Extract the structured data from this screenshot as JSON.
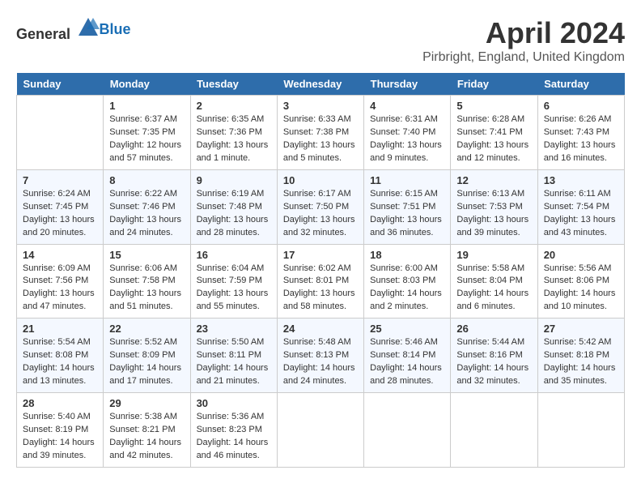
{
  "header": {
    "logo_general": "General",
    "logo_blue": "Blue",
    "month": "April 2024",
    "location": "Pirbright, England, United Kingdom"
  },
  "days_of_week": [
    "Sunday",
    "Monday",
    "Tuesday",
    "Wednesday",
    "Thursday",
    "Friday",
    "Saturday"
  ],
  "weeks": [
    [
      {
        "day": "",
        "text": ""
      },
      {
        "day": "1",
        "text": "Sunrise: 6:37 AM\nSunset: 7:35 PM\nDaylight: 12 hours\nand 57 minutes."
      },
      {
        "day": "2",
        "text": "Sunrise: 6:35 AM\nSunset: 7:36 PM\nDaylight: 13 hours\nand 1 minute."
      },
      {
        "day": "3",
        "text": "Sunrise: 6:33 AM\nSunset: 7:38 PM\nDaylight: 13 hours\nand 5 minutes."
      },
      {
        "day": "4",
        "text": "Sunrise: 6:31 AM\nSunset: 7:40 PM\nDaylight: 13 hours\nand 9 minutes."
      },
      {
        "day": "5",
        "text": "Sunrise: 6:28 AM\nSunset: 7:41 PM\nDaylight: 13 hours\nand 12 minutes."
      },
      {
        "day": "6",
        "text": "Sunrise: 6:26 AM\nSunset: 7:43 PM\nDaylight: 13 hours\nand 16 minutes."
      }
    ],
    [
      {
        "day": "7",
        "text": "Sunrise: 6:24 AM\nSunset: 7:45 PM\nDaylight: 13 hours\nand 20 minutes."
      },
      {
        "day": "8",
        "text": "Sunrise: 6:22 AM\nSunset: 7:46 PM\nDaylight: 13 hours\nand 24 minutes."
      },
      {
        "day": "9",
        "text": "Sunrise: 6:19 AM\nSunset: 7:48 PM\nDaylight: 13 hours\nand 28 minutes."
      },
      {
        "day": "10",
        "text": "Sunrise: 6:17 AM\nSunset: 7:50 PM\nDaylight: 13 hours\nand 32 minutes."
      },
      {
        "day": "11",
        "text": "Sunrise: 6:15 AM\nSunset: 7:51 PM\nDaylight: 13 hours\nand 36 minutes."
      },
      {
        "day": "12",
        "text": "Sunrise: 6:13 AM\nSunset: 7:53 PM\nDaylight: 13 hours\nand 39 minutes."
      },
      {
        "day": "13",
        "text": "Sunrise: 6:11 AM\nSunset: 7:54 PM\nDaylight: 13 hours\nand 43 minutes."
      }
    ],
    [
      {
        "day": "14",
        "text": "Sunrise: 6:09 AM\nSunset: 7:56 PM\nDaylight: 13 hours\nand 47 minutes."
      },
      {
        "day": "15",
        "text": "Sunrise: 6:06 AM\nSunset: 7:58 PM\nDaylight: 13 hours\nand 51 minutes."
      },
      {
        "day": "16",
        "text": "Sunrise: 6:04 AM\nSunset: 7:59 PM\nDaylight: 13 hours\nand 55 minutes."
      },
      {
        "day": "17",
        "text": "Sunrise: 6:02 AM\nSunset: 8:01 PM\nDaylight: 13 hours\nand 58 minutes."
      },
      {
        "day": "18",
        "text": "Sunrise: 6:00 AM\nSunset: 8:03 PM\nDaylight: 14 hours\nand 2 minutes."
      },
      {
        "day": "19",
        "text": "Sunrise: 5:58 AM\nSunset: 8:04 PM\nDaylight: 14 hours\nand 6 minutes."
      },
      {
        "day": "20",
        "text": "Sunrise: 5:56 AM\nSunset: 8:06 PM\nDaylight: 14 hours\nand 10 minutes."
      }
    ],
    [
      {
        "day": "21",
        "text": "Sunrise: 5:54 AM\nSunset: 8:08 PM\nDaylight: 14 hours\nand 13 minutes."
      },
      {
        "day": "22",
        "text": "Sunrise: 5:52 AM\nSunset: 8:09 PM\nDaylight: 14 hours\nand 17 minutes."
      },
      {
        "day": "23",
        "text": "Sunrise: 5:50 AM\nSunset: 8:11 PM\nDaylight: 14 hours\nand 21 minutes."
      },
      {
        "day": "24",
        "text": "Sunrise: 5:48 AM\nSunset: 8:13 PM\nDaylight: 14 hours\nand 24 minutes."
      },
      {
        "day": "25",
        "text": "Sunrise: 5:46 AM\nSunset: 8:14 PM\nDaylight: 14 hours\nand 28 minutes."
      },
      {
        "day": "26",
        "text": "Sunrise: 5:44 AM\nSunset: 8:16 PM\nDaylight: 14 hours\nand 32 minutes."
      },
      {
        "day": "27",
        "text": "Sunrise: 5:42 AM\nSunset: 8:18 PM\nDaylight: 14 hours\nand 35 minutes."
      }
    ],
    [
      {
        "day": "28",
        "text": "Sunrise: 5:40 AM\nSunset: 8:19 PM\nDaylight: 14 hours\nand 39 minutes."
      },
      {
        "day": "29",
        "text": "Sunrise: 5:38 AM\nSunset: 8:21 PM\nDaylight: 14 hours\nand 42 minutes."
      },
      {
        "day": "30",
        "text": "Sunrise: 5:36 AM\nSunset: 8:23 PM\nDaylight: 14 hours\nand 46 minutes."
      },
      {
        "day": "",
        "text": ""
      },
      {
        "day": "",
        "text": ""
      },
      {
        "day": "",
        "text": ""
      },
      {
        "day": "",
        "text": ""
      }
    ]
  ]
}
